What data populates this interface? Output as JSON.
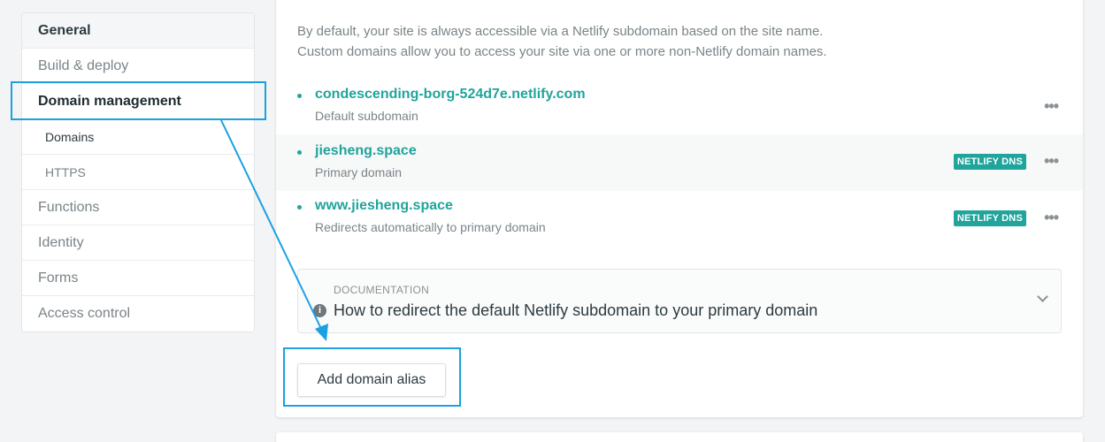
{
  "sidebar": {
    "items": [
      {
        "label": "General"
      },
      {
        "label": "Build & deploy"
      },
      {
        "label": "Domain management"
      },
      {
        "label": "Domains"
      },
      {
        "label": "HTTPS"
      },
      {
        "label": "Functions"
      },
      {
        "label": "Identity"
      },
      {
        "label": "Forms"
      },
      {
        "label": "Access control"
      }
    ]
  },
  "main": {
    "intro_line1": "By default, your site is always accessible via a Netlify subdomain based on the site name.",
    "intro_line2": "Custom domains allow you to access your site via one or more non-Netlify domain names.",
    "domains": [
      {
        "name": "condescending-borg-524d7e.netlify.com",
        "desc": "Default subdomain",
        "badge": null
      },
      {
        "name": "jiesheng.space",
        "desc": "Primary domain",
        "badge": "NETLIFY DNS"
      },
      {
        "name": "www.jiesheng.space",
        "desc": "Redirects automatically to primary domain",
        "badge": "NETLIFY DNS"
      }
    ],
    "doc": {
      "label": "DOCUMENTATION",
      "title": "How to redirect the default Netlify subdomain to your primary domain"
    },
    "add_button": "Add domain alias",
    "more_glyph": "•••"
  },
  "colors": {
    "accent": "#20a49b",
    "annotation": "#1ba1e2"
  }
}
